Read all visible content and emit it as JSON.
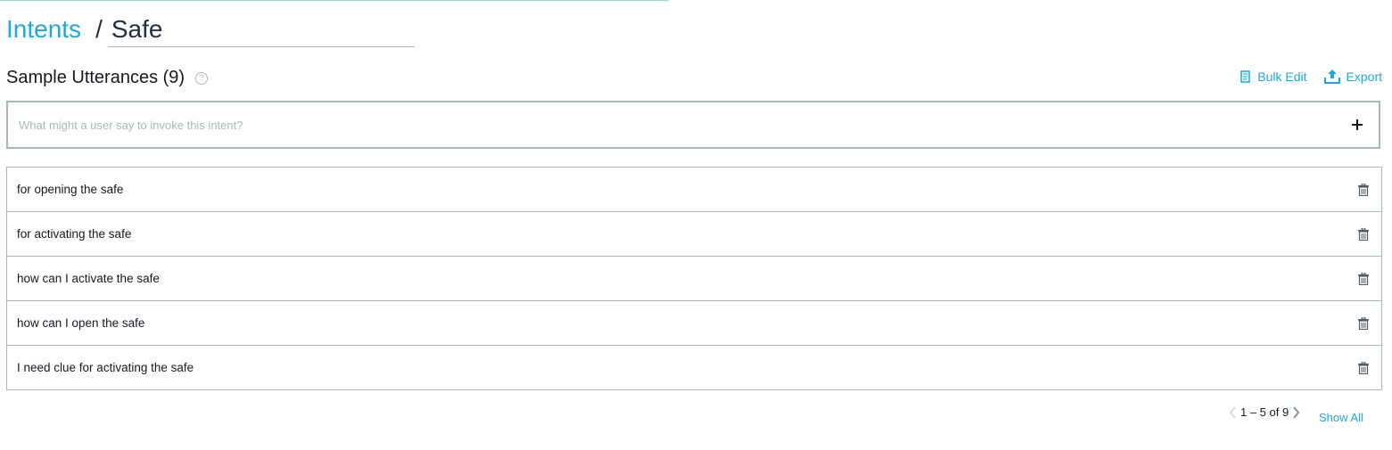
{
  "breadcrumb": {
    "parent": "Intents",
    "separator": "/",
    "current": "Safe"
  },
  "section": {
    "title": "Sample Utterances (9)",
    "help_icon": "?"
  },
  "actions": {
    "bulk_edit": "Bulk Edit",
    "export": "Export"
  },
  "utterance_input": {
    "placeholder": "What might a user say to invoke this intent?",
    "value": ""
  },
  "utterances": [
    "for opening the safe",
    "for activating the safe",
    "how can I activate the safe",
    "how can I open the safe",
    "I need clue for activating the safe"
  ],
  "pagination": {
    "range": "1 – 5 of 9",
    "show_all": "Show All"
  },
  "colors": {
    "accent": "#1ea7e0",
    "border": "#aab7b8",
    "text": "#16191f"
  }
}
